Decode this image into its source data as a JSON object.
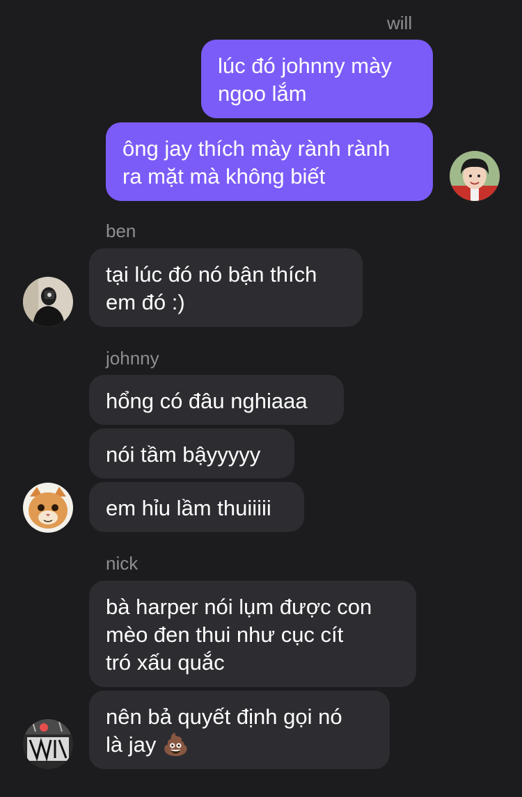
{
  "messages": [
    {
      "sender": "will",
      "lines": [
        "lúc đó johnny mày\nngoo lắm",
        "ông jay thích mày rành rành\nra mặt mà không biết"
      ]
    },
    {
      "sender": "ben",
      "lines": [
        "tại lúc đó nó bận thích\nem đó :)"
      ]
    },
    {
      "sender": "johnny",
      "lines": [
        "hổng có đâu nghiaaa",
        "nói tầm bậyyyyy",
        "em hỉu lầm thuiiiii"
      ]
    },
    {
      "sender": "nick",
      "lines": [
        "bà harper nói lụm được con\nmèo đen thui như cục cít\ntró xấu quắc",
        "nên bả quyết định gọi nó\nlà jay 💩"
      ]
    }
  ],
  "avatars": {
    "will": "child-photo",
    "ben": "person-dark-photo",
    "johnny": "orange-cat-photo",
    "nick": "graffiti-photo"
  }
}
